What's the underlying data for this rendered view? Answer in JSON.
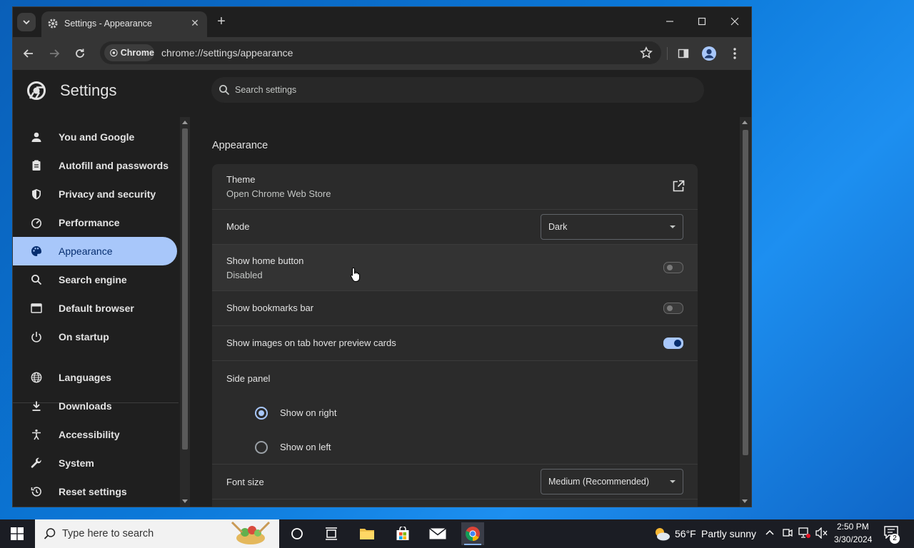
{
  "browser": {
    "tab_title": "Settings - Appearance",
    "new_tab_symbol": "+",
    "chip_label": "Chrome",
    "url": "chrome://settings/appearance"
  },
  "settings": {
    "title": "Settings",
    "search_placeholder": "Search settings",
    "nav_items": [
      {
        "label": "You and Google",
        "icon": "person-icon"
      },
      {
        "label": "Autofill and passwords",
        "icon": "clipboard-icon"
      },
      {
        "label": "Privacy and security",
        "icon": "shield-icon"
      },
      {
        "label": "Performance",
        "icon": "speedometer-icon"
      },
      {
        "label": "Appearance",
        "icon": "palette-icon",
        "active": true
      },
      {
        "label": "Search engine",
        "icon": "search-icon"
      },
      {
        "label": "Default browser",
        "icon": "browser-icon"
      },
      {
        "label": "On startup",
        "icon": "power-icon"
      },
      {
        "label": "Languages",
        "icon": "globe-icon"
      },
      {
        "label": "Downloads",
        "icon": "download-icon"
      },
      {
        "label": "Accessibility",
        "icon": "accessibility-icon"
      },
      {
        "label": "System",
        "icon": "wrench-icon"
      },
      {
        "label": "Reset settings",
        "icon": "history-icon"
      }
    ],
    "section_title": "Appearance",
    "theme": {
      "title": "Theme",
      "subtitle": "Open Chrome Web Store"
    },
    "mode": {
      "title": "Mode",
      "value": "Dark"
    },
    "home_button": {
      "title": "Show home button",
      "subtitle": "Disabled",
      "enabled": false
    },
    "bookmarks_bar": {
      "title": "Show bookmarks bar",
      "enabled": false
    },
    "tab_hover": {
      "title": "Show images on tab hover preview cards",
      "enabled": true
    },
    "side_panel": {
      "title": "Side panel",
      "options": [
        "Show on right",
        "Show on left"
      ],
      "selected": "Show on right"
    },
    "font_size": {
      "title": "Font size",
      "value": "Medium (Recommended)"
    }
  },
  "taskbar": {
    "search_placeholder": "Type here to search",
    "weather_temp": "56°F",
    "weather_desc": "Partly sunny",
    "time": "2:50 PM",
    "date": "3/30/2024",
    "notification_count": "2"
  },
  "colors": {
    "accent": "#a8c7fa",
    "window_bg": "#1f1f1f",
    "card_bg": "#2b2b2b",
    "desktop": "#0b78d8"
  }
}
